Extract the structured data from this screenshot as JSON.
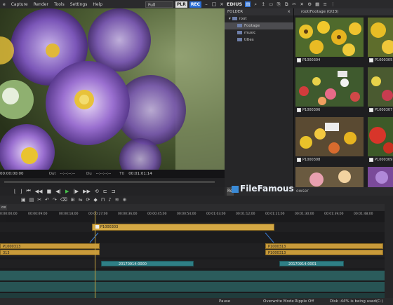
{
  "menu": {
    "items": [
      "e",
      "Capture",
      "Render",
      "Tools",
      "Settings",
      "Help"
    ],
    "preview_mode": "Full",
    "plr": "PLR",
    "rec": "REC"
  },
  "right_toolbar": {
    "app": "EDIUS"
  },
  "player": {
    "in_tc": "00:00:00:00",
    "out_label": "Out",
    "out_tc": "--:--:--:--",
    "dur_label": "Du",
    "dur_tc": "--:--:--:--",
    "ttl_label": "Ttl",
    "ttl_tc": "00:01:01:14"
  },
  "folder": {
    "header": "FOLDER",
    "items": [
      {
        "label": "root"
      },
      {
        "label": "Footage"
      },
      {
        "label": "music"
      },
      {
        "label": "titles"
      }
    ]
  },
  "bin": {
    "path": "root/Footage (0/23)",
    "clips": [
      "P1000304",
      "P1000305",
      "P1000306",
      "P1000307",
      "P1000308",
      "P1000309"
    ]
  },
  "bin_status_label": "Re",
  "bin_status_text": "owser",
  "watermark": "FileFamous",
  "timeline": {
    "ruler_label": "ce",
    "ticks": [
      "0:00:00;00",
      "00:00:09:00",
      "00:00:18;00",
      "00:00:27;00",
      "00:00:36;00",
      "00:00:45;00",
      "00:00:54;00",
      "00:01:03;00",
      "00:01:12;00",
      "00:01:21;00",
      "00:01:30;00",
      "00:01:39;00",
      "00:01:48;00"
    ],
    "clips": {
      "top_clip": "P1000303",
      "v_left_1": "P1000313",
      "v_left_2": "313",
      "v_right_1": "P1000313",
      "v_right_2": "P1000313",
      "audio_1": "20170914-0000",
      "audio_2": "20170914-0001"
    }
  },
  "status": {
    "pause": "Pause",
    "overwrite": "Overwrite Mode",
    "ripple": "Ripple Off",
    "disk": "Disk :44% is being used(C:)"
  },
  "colors": {
    "accent": "#2b6fd6",
    "clip": "#c89a3a",
    "audio_clip": "#2f7f86",
    "playhead": "#c6a440"
  }
}
